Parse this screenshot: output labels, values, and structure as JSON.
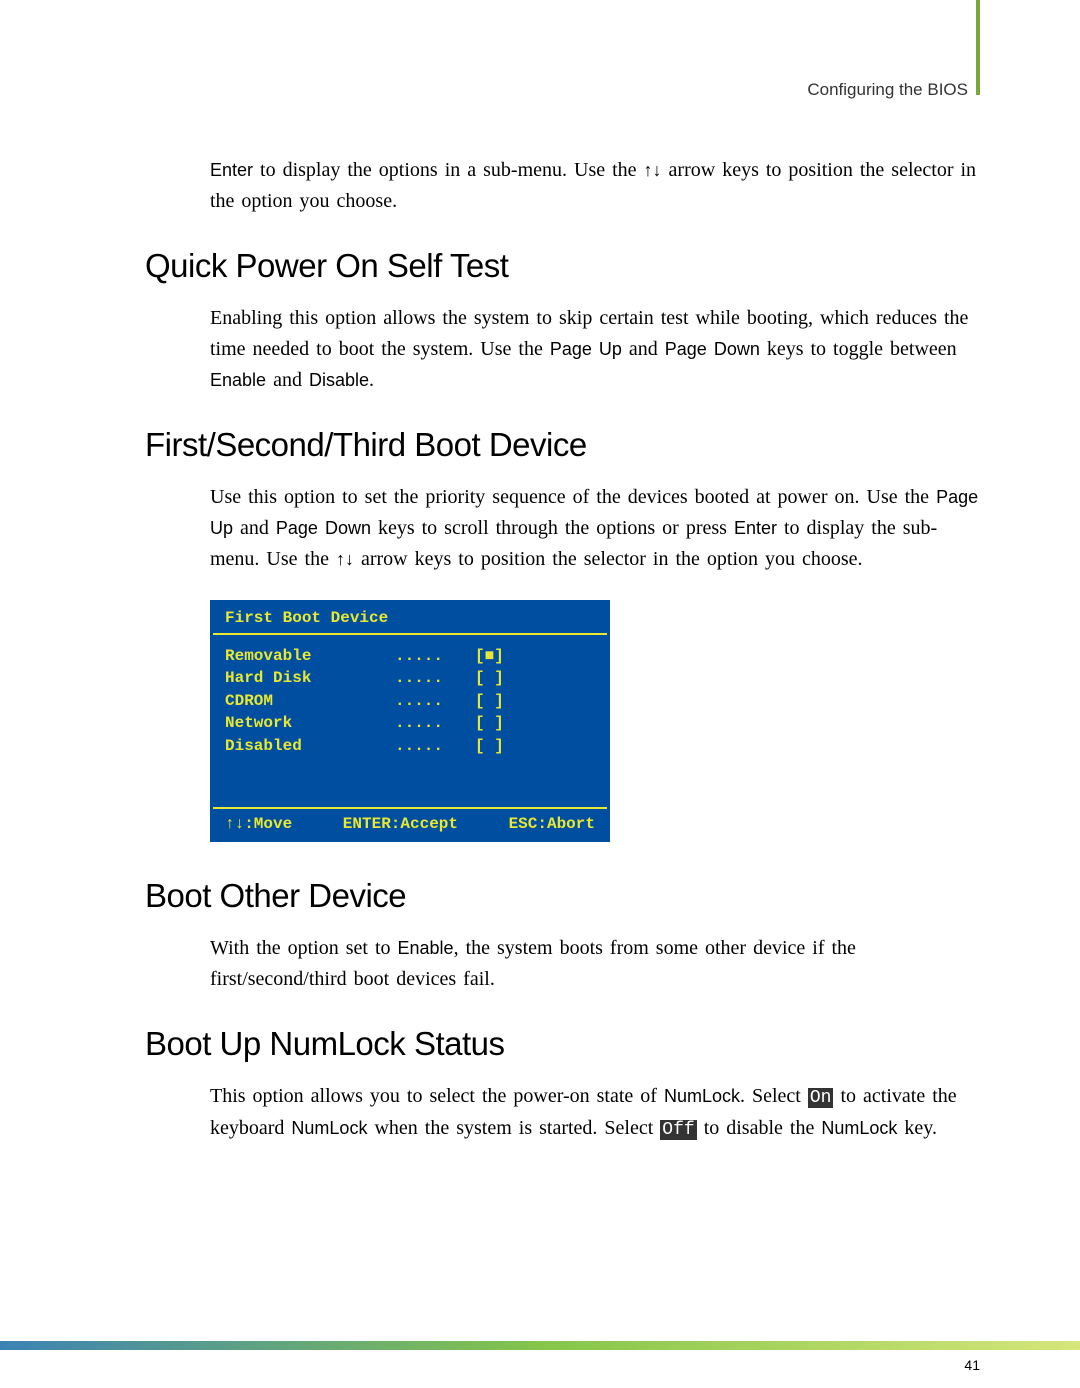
{
  "header": "Configuring the BIOS",
  "intro_paragraph": {
    "part1": "Enter",
    "part2": " to display the options in a sub-menu. Use the ",
    "arrows": "↑↓",
    "part3": " arrow keys to position the selector in the option you choose."
  },
  "sections": {
    "quick_power": {
      "heading": "Quick Power On Self Test",
      "text_parts": {
        "p1": "Enabling this option allows the system to skip certain test while booting, which reduces the time needed to boot the system. Use the ",
        "pageup": "Page Up",
        "p2": " and ",
        "pagedown": "Page Down",
        "p3": " keys to toggle between ",
        "enable": "Enable",
        "p4": " and ",
        "disable": "Disable",
        "p5": "."
      }
    },
    "boot_device": {
      "heading": "First/Second/Third Boot Device",
      "text_parts": {
        "p1": "Use this option to set the priority sequence of the devices booted at power on.  Use the ",
        "pageup": "Page Up",
        "p2": " and ",
        "pagedown": "Page Down",
        "p3": " keys to scroll through the options or press ",
        "enter": "Enter",
        "p4": " to display the sub-menu. Use the ",
        "arrows": "↑↓",
        "p5": " arrow keys to position the selector in the option you choose."
      }
    },
    "boot_other": {
      "heading": "Boot Other Device",
      "text_parts": {
        "p1": "With the option set to ",
        "enable": "Enable",
        "p2": ", the system boots from some other device if the first/second/third boot devices fail."
      }
    },
    "numlock": {
      "heading": "Boot Up NumLock Status",
      "text_parts": {
        "p1": "This option allows you to select the power-on state of ",
        "numlock1": "NumLock",
        "p2": ". Select ",
        "on": "On",
        "p3": " to activate the keyboard ",
        "numlock2": "NumLock",
        "p4": " when the system is started. Select ",
        "off": "Off",
        "p5": " to disable the ",
        "numlock3": "NumLock",
        "p6": " key."
      }
    }
  },
  "bios_box": {
    "title": "First Boot Device",
    "items": [
      {
        "label": "Removable",
        "dots": ".....",
        "marker": "[■]"
      },
      {
        "label": "Hard Disk",
        "dots": ".....",
        "marker": "[ ]"
      },
      {
        "label": "CDROM",
        "dots": ".....",
        "marker": "[ ]"
      },
      {
        "label": "Network",
        "dots": ".....",
        "marker": "[ ]"
      },
      {
        "label": "Disabled",
        "dots": ".....",
        "marker": "[ ]"
      }
    ],
    "footer": {
      "move": "↑↓:Move",
      "accept": "ENTER:Accept",
      "abort": "ESC:Abort"
    }
  },
  "page_number": "41"
}
